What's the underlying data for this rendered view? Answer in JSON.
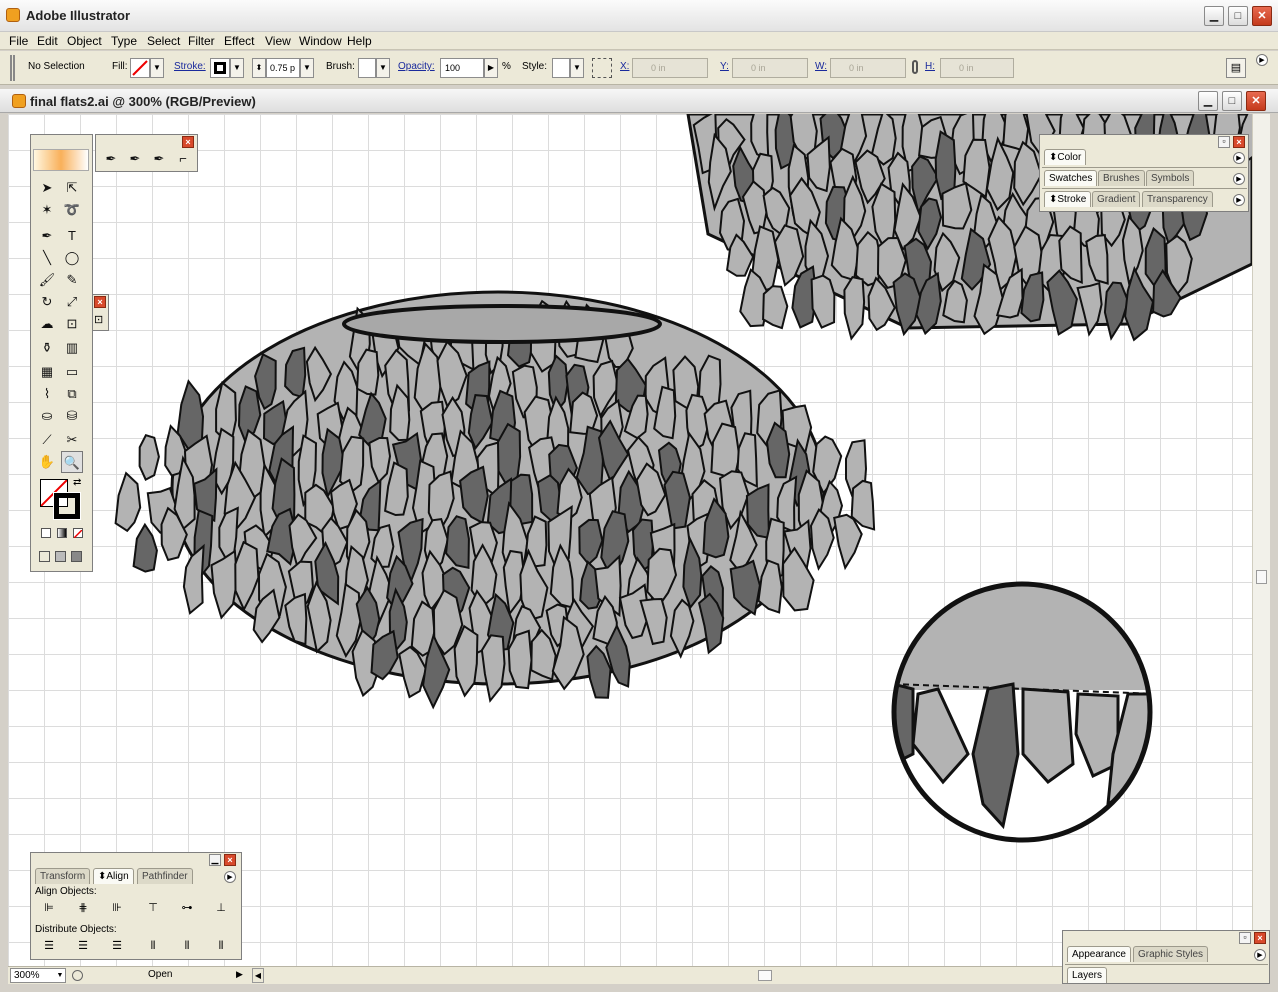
{
  "app": {
    "title": "Adobe Illustrator",
    "window_controls": {
      "minimize": "▁",
      "maximize": "□",
      "close": "✕"
    }
  },
  "menu": {
    "items": [
      "File",
      "Edit",
      "Object",
      "Type",
      "Select",
      "Filter",
      "Effect",
      "View",
      "Window",
      "Help"
    ]
  },
  "control": {
    "selection": "No Selection",
    "fill_label": "Fill:",
    "stroke_label": "Stroke:",
    "stroke_weight": "0.75 p",
    "brush_label": "Brush:",
    "opacity_label": "Opacity:",
    "opacity_value": "100",
    "opacity_unit": "%",
    "style_label": "Style:",
    "x_label": "X:",
    "x_value": "0 in",
    "y_label": "Y:",
    "y_value": "0 in",
    "w_label": "W:",
    "w_value": "0 in",
    "h_label": "H:",
    "h_value": "0 in"
  },
  "document": {
    "title": "final flats2.ai @ 300% (RGB/Preview)",
    "zoom": "300%",
    "status": "Open"
  },
  "palettes": {
    "color_tab": "Color",
    "swatches_group": [
      "Swatches",
      "Brushes",
      "Symbols"
    ],
    "stroke_group": [
      "Stroke",
      "Gradient",
      "Transparency"
    ],
    "align_tabs": [
      "Transform",
      "Align",
      "Pathfinder"
    ],
    "align_objects": "Align Objects:",
    "distribute_objects": "Distribute Objects:",
    "appearance_tabs": [
      "Appearance",
      "Graphic Styles"
    ],
    "layers_tab": "Layers"
  },
  "toolbox": {
    "tools": [
      "selection-tool",
      "direct-selection-tool",
      "magic-wand-tool",
      "lasso-tool",
      "pen-tool",
      "type-tool",
      "line-tool",
      "ellipse-tool",
      "paintbrush-tool",
      "pencil-tool",
      "rotate-tool",
      "scale-tool",
      "warp-tool",
      "free-transform-tool",
      "symbol-sprayer-tool",
      "graph-tool",
      "mesh-tool",
      "gradient-tool",
      "eyedropper-tool",
      "blend-tool",
      "live-paint-tool",
      "live-paint-selection-tool",
      "slice-tool",
      "scissors-tool",
      "hand-tool",
      "zoom-tool"
    ],
    "selected_tool": "zoom-tool"
  },
  "colors": {
    "accent_link": "#1a2a9c",
    "patch_light": "#b3b3b3",
    "patch_dark": "#666666",
    "canvas_grid": "#dcdcdc"
  }
}
